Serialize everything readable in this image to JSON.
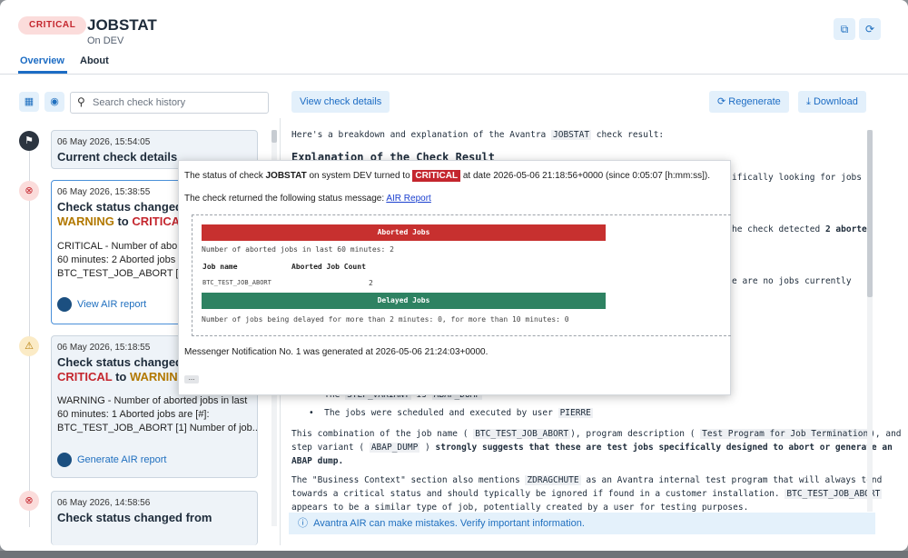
{
  "header": {
    "badge": "CRITICAL",
    "title": "JOBSTAT",
    "subtitle": "On DEV",
    "tabs": [
      "Overview",
      "About"
    ]
  },
  "left": {
    "search_placeholder": "Search check history",
    "history": [
      {
        "date": "06 May 2026, 15:54:05",
        "title": "Current check details"
      },
      {
        "date": "06 May 2026, 15:38:55",
        "title": "Check status changed",
        "from": "WARNING",
        "to_word": "to",
        "to": "CRITICAL",
        "msg": [
          "CRITICAL - Number of aborted",
          "60 minutes: 2 Aborted jobs",
          "BTC_TEST_JOB_ABORT [2]"
        ],
        "link": "View AIR report"
      },
      {
        "date": "06 May 2026, 15:18:55",
        "title": "Check status changed",
        "from": "CRITICAL",
        "to_word": "to",
        "to": "WARNING",
        "msg": [
          "WARNING - Number of aborted jobs in last",
          "60 minutes: 1 Aborted jobs are [#]:",
          "BTC_TEST_JOB_ABORT [1] Number of job..."
        ],
        "link": "Generate AIR report"
      },
      {
        "date": "06 May 2026, 14:58:56",
        "title": "Check status changed from"
      }
    ]
  },
  "right": {
    "view_details": "View check details",
    "regenerate": "Regenerate",
    "download": "Download",
    "intro_a": "Here's a breakdown and explanation of the Avantra",
    "intro_code": "JOBSTAT",
    "intro_b": "check result:",
    "heading": "Explanation of the Check Result",
    "r1": "ifically looking for jobs",
    "r2a": "he check detected",
    "r2b": "2 aborted",
    "r3": "e are no jobs currently",
    "b1a": "The",
    "b1b": "STEP_VARIANT",
    "b1c": "is",
    "b1d": "ABAP_DUMP",
    "b2a": "The jobs were scheduled and executed by user",
    "b2b": "PIERRE",
    "p1a": "This combination of the job name (",
    "p1b": "BTC_TEST_JOB_ABORT",
    "p1c": "), program description (",
    "p1d": "Test Program for Job Termination",
    "p1e": "), and",
    "p2a": "step variant (",
    "p2b": "ABAP_DUMP",
    "p2c": ")",
    "p2d": "strongly suggests that these are test jobs specifically designed to abort or generate an",
    "p3": "ABAP dump.",
    "p4a": "The \"Business Context\" section also mentions",
    "p4b": "ZDRAGCHUTE",
    "p4c": "as an Avantra internal test program that will always tend",
    "p5": "towards a critical status and should typically be ignored if found in a customer installation.",
    "p5b": "BTC_TEST_JOB_ABORT",
    "p6": "appears to be a similar type of job, potentially created by a user for testing purposes.",
    "disclaimer": "Avantra AIR can make mistakes. Verify important information."
  },
  "popup": {
    "l1a": "The status of check",
    "l1b": "JOBSTAT",
    "l1c": "on system DEV turned to",
    "l1d": "CRITICAL",
    "l1e": "at date 2026-05-06 21:18:56+0000 (since 0:05:07 [h:mm:ss]).",
    "l2a": "The check returned the following status message:",
    "l2b": "AIR Report",
    "aborted_title": "Aborted Jobs",
    "aborted_summary": "Number of aborted jobs in last 60 minutes: 2",
    "col_job": "Job name",
    "col_count": "Aborted Job Count",
    "row_job": "BTC_TEST_JOB_ABORT",
    "row_count": "2",
    "delayed_title": "Delayed Jobs",
    "delayed_summary": "Number of jobs being delayed for more than 2 minutes: 0, for more than 10 minutes: 0",
    "messenger": "Messenger Notification No. 1 was generated at 2026-05-06 21:24:03+0000.",
    "more": "..."
  },
  "icons": {
    "open_external": "open-external-icon",
    "refresh": "refresh-icon",
    "calendar": "calendar-icon",
    "filter": "filter-icon",
    "search": "search-icon",
    "flag": "flag-icon",
    "critical": "critical-x-icon",
    "warning": "warning-triangle-icon",
    "info": "info-icon"
  },
  "colors": {
    "accent": "#1c6cc4",
    "critical": "#c4262e",
    "warning": "#b27800",
    "aborted_bar": "#c7302f",
    "delayed_bar": "#2e8262"
  }
}
